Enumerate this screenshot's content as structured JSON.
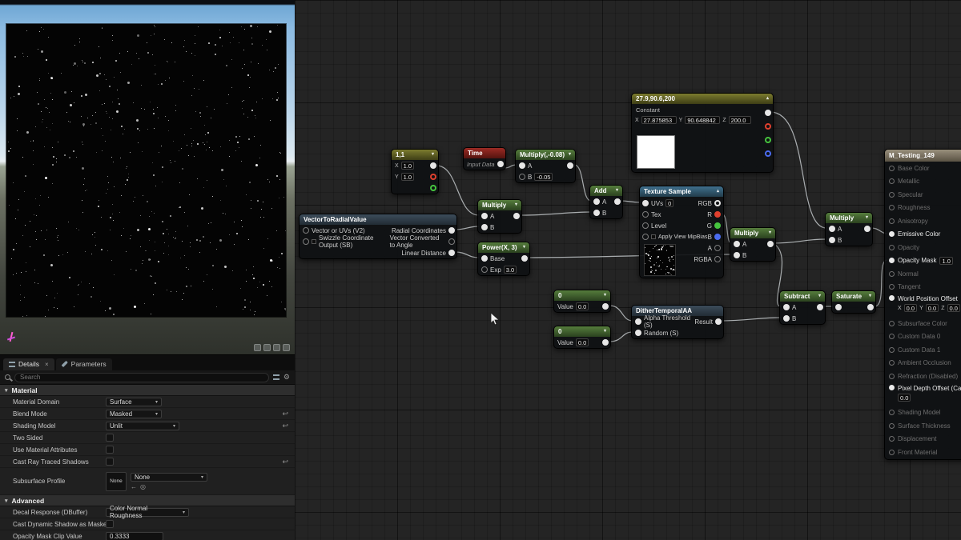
{
  "icons": {
    "chevron_down": "▾",
    "chevron_up": "▴",
    "close": "×",
    "gear": "⚙",
    "reset": "↩",
    "use_arrow": "←",
    "browse": "◎"
  },
  "colors": {
    "pin_red": "#e0402e",
    "pin_green": "#46c43f",
    "pin_blue": "#4b6cf0",
    "header_green": "#557d3c",
    "header_red": "#9c2b24",
    "header_blue": "#3f6f8d"
  },
  "details": {
    "tabs": {
      "details": "Details",
      "parameters": "Parameters"
    },
    "search": {
      "placeholder": "Search"
    },
    "sections": {
      "material": "Material",
      "advanced": "Advanced"
    },
    "fields": {
      "material_domain": {
        "label": "Material Domain",
        "value": "Surface"
      },
      "blend_mode": {
        "label": "Blend Mode",
        "value": "Masked"
      },
      "shading_model": {
        "label": "Shading Model",
        "value": "Unlit"
      },
      "two_sided": {
        "label": "Two Sided"
      },
      "use_material_attributes": {
        "label": "Use Material Attributes"
      },
      "cast_ray_traced_shadows": {
        "label": "Cast Ray Traced Shadows"
      },
      "subsurface_profile": {
        "label": "Subsurface Profile",
        "thumb": "None",
        "value": "None"
      },
      "decal_response": {
        "label": "Decal Response (DBuffer)",
        "value": "Color Normal Roughness"
      },
      "cast_dynamic_shadow_as_masked": {
        "label": "Cast Dynamic Shadow as Masked"
      },
      "opacity_mask_clip_value": {
        "label": "Opacity Mask Clip Value",
        "value": "0.3333"
      }
    }
  },
  "graph": {
    "nodes": {
      "const2": {
        "title": "1,1",
        "x_label": "X",
        "x_value": "1.0",
        "y_label": "Y",
        "y_value": "1.0"
      },
      "time": {
        "title": "Time",
        "subtitle": "Input Data"
      },
      "multiplyC": {
        "title": "Multiply(,-0.08)",
        "a": "A",
        "b": "B",
        "b_value": "-0.05"
      },
      "add": {
        "title": "Add",
        "a": "A",
        "b": "B"
      },
      "multiplyE": {
        "title": "Multiply",
        "a": "A",
        "b": "B"
      },
      "v2r": {
        "title": "VectorToRadialValue",
        "in1": "Vector or UVs (V2)",
        "in2": "Swizzle Coordinate Output (SB)",
        "out1": "Radial Coordinates",
        "out2": "Vector Converted to Angle",
        "out3": "Linear Distance"
      },
      "power": {
        "title": "Power(X, 3)",
        "base": "Base",
        "exp": "Exp",
        "exp_value": "3.0"
      },
      "const3": {
        "title": "27.9,90.6,200",
        "label": "Constant",
        "x_label": "X",
        "x_value": "27.875853",
        "y_label": "Y",
        "y_value": "90.648842",
        "z_label": "Z",
        "z_value": "200.0"
      },
      "texsample": {
        "title": "Texture Sample",
        "uvs": "UVs",
        "uvs_value": "0",
        "tex": "Tex",
        "level": "Level",
        "mip": "Apply View MipBias",
        "rgb": "RGB",
        "r": "R",
        "g": "G",
        "b": "B",
        "a": "A",
        "rgba": "RGBA"
      },
      "dither": {
        "title": "DitherTemporalAA",
        "in1": "Alpha Threshold (S)",
        "in2": "Random (S)",
        "out": "Result"
      },
      "zero1": {
        "title": "0",
        "value_label": "Value",
        "value": "0.0"
      },
      "zero2": {
        "title": "0",
        "value_label": "Value",
        "value": "0.0"
      },
      "multiplyM": {
        "title": "Multiply",
        "a": "A",
        "b": "B"
      },
      "multiplyN": {
        "title": "Multiply",
        "a": "A",
        "b": "B"
      },
      "subtract": {
        "title": "Subtract",
        "a": "A",
        "b": "B"
      },
      "saturate": {
        "title": "Saturate"
      },
      "result": {
        "title": "M_Testing_149",
        "inputs": [
          "Base Color",
          "Metallic",
          "Specular",
          "Roughness",
          "Anisotropy",
          "Emissive Color",
          "Opacity",
          "Opacity Mask",
          "Normal",
          "Tangent",
          "World Position Offset",
          "Subsurface Color",
          "Custom Data 0",
          "Custom Data 1",
          "Ambient Occlusion",
          "Refraction (Disabled)",
          "Pixel Depth Offset (Came",
          "Shading Model",
          "Surface Thickness",
          "Displacement",
          "Front Material"
        ],
        "opacity_mask_value": "1.0",
        "wpo": {
          "x_label": "X",
          "x_value": "0.0",
          "y_label": "Y",
          "y_value": "0.0",
          "z_label": "Z",
          "z_value": "0.0"
        },
        "pixel_depth_value": "0.0"
      }
    }
  }
}
